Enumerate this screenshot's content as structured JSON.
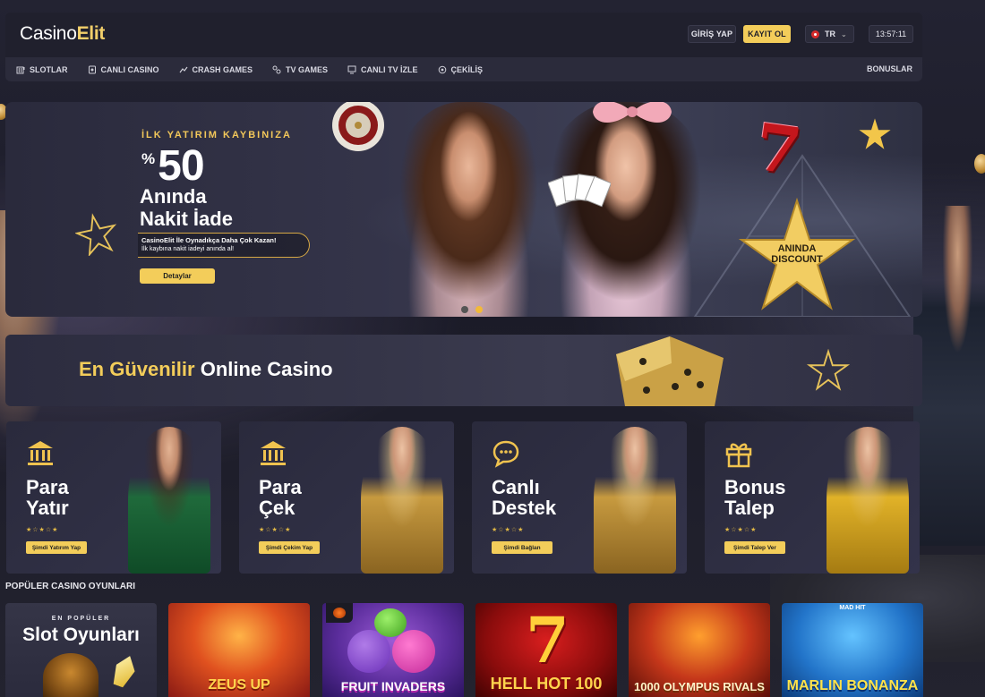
{
  "brand": {
    "logo_main": "Casino",
    "logo_accent": "Elit"
  },
  "header": {
    "login_label": "GİRİŞ YAP",
    "register_label": "KAYIT OL",
    "language": "TR",
    "clock": "13:57:11"
  },
  "nav": {
    "items": [
      {
        "label": "SLOTLAR",
        "icon": "slot-machine-icon"
      },
      {
        "label": "CANLI CASINO",
        "icon": "live-casino-icon"
      },
      {
        "label": "CRASH GAMES",
        "icon": "crash-icon"
      },
      {
        "label": "TV GAMES",
        "icon": "tv-games-icon"
      },
      {
        "label": "CANLI TV İZLE",
        "icon": "tv-icon"
      },
      {
        "label": "ÇEKİLİŞ",
        "icon": "raffle-icon"
      }
    ],
    "right_label": "BONUSLAR"
  },
  "hero": {
    "eyebrow": "İLK YATIRIM KAYBINIZA",
    "percent_symbol": "%",
    "percent_value": "50",
    "line1": "Anında",
    "line2": "Nakit İade",
    "sub_line1": "CasinoElit İle Oynadıkça Daha Çok Kazan!",
    "sub_line2": "İlk kaybına nakit iadeyi anında al!",
    "details_label": "Detaylar",
    "badge_text": "ANINDA DISCOUNT",
    "slide_count": 2,
    "active_slide": 2
  },
  "trust": {
    "highlight": "En Güvenilir",
    "rest": " Online Casino"
  },
  "cards": [
    {
      "line1": "Para",
      "line2": "Yatır",
      "button": "Şimdi Yatırım Yap",
      "icon": "bank-icon"
    },
    {
      "line1": "Para",
      "line2": "Çek",
      "button": "Şimdi Çekim Yap",
      "icon": "bank-icon"
    },
    {
      "line1": "Canlı",
      "line2": "Destek",
      "button": "Şimdi Bağlan",
      "icon": "chat-icon"
    },
    {
      "line1": "Bonus",
      "line2": "Talep",
      "button": "Şimdi Talep Ver",
      "icon": "gift-icon"
    }
  ],
  "popular": {
    "title": "POPÜLER CASINO OYUNLARI",
    "slot_eyebrow": "EN POPÜLER",
    "slot_title": "Slot Oyunları",
    "games": [
      {
        "name": "ZEUS UP"
      },
      {
        "name": "FRUIT INVADERS"
      },
      {
        "name": "HELL HOT 100"
      },
      {
        "name": "1000 OLYMPUS RIVALS"
      },
      {
        "name": "MARLIN BONANZA",
        "sub": "MAD HIT"
      }
    ]
  },
  "colors": {
    "accent": "#f3cd5a",
    "bg": "#1b1b28",
    "panel": "#2b2b3b"
  }
}
